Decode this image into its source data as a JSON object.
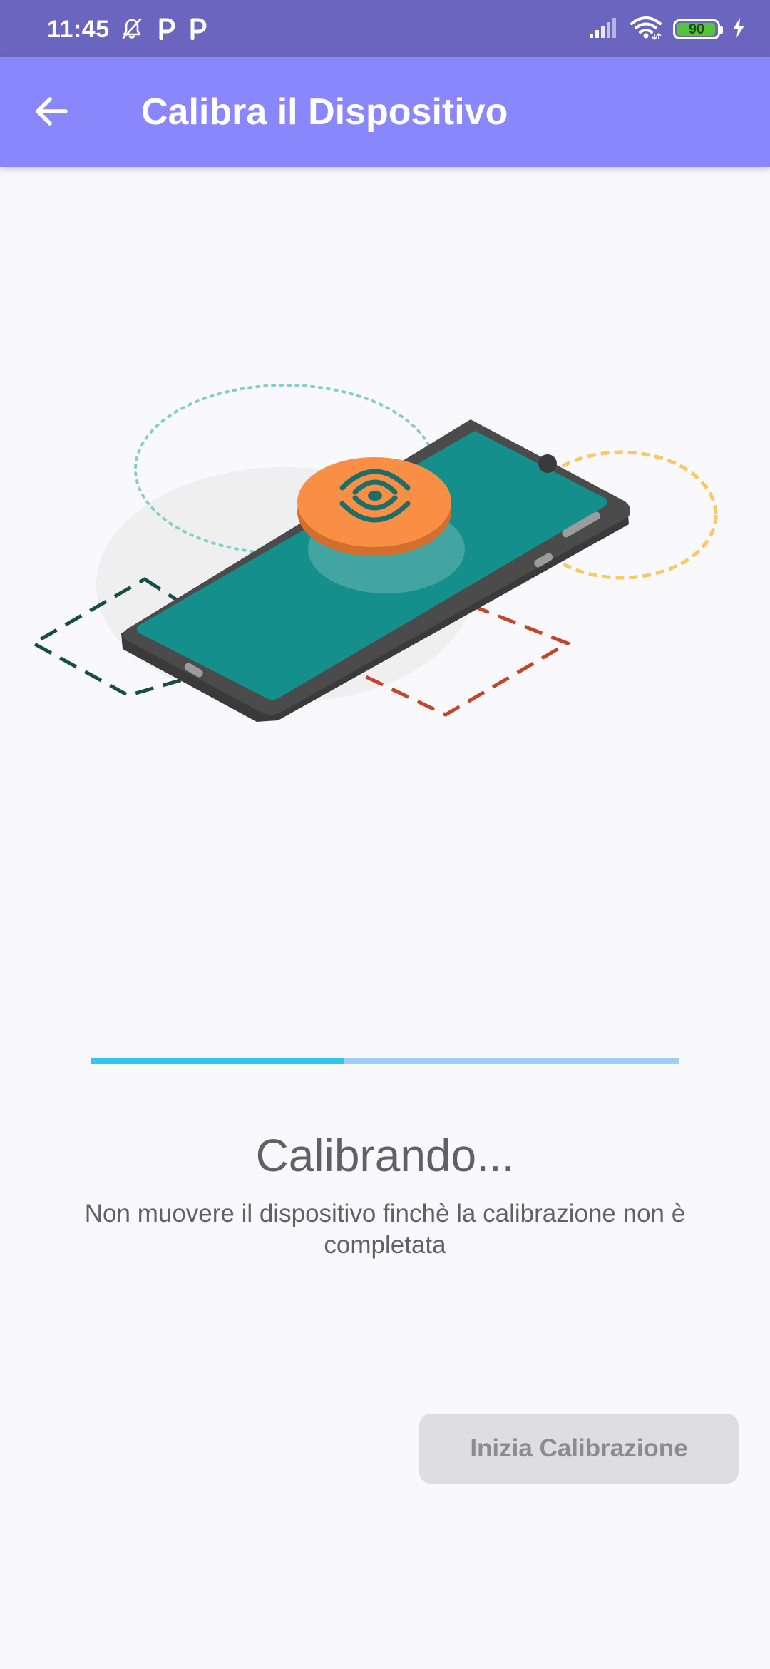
{
  "status_bar": {
    "time": "11:45",
    "battery_level": "90",
    "icons": [
      "bell-off-icon",
      "parking-p-icon",
      "parking-p-icon",
      "signal-icon",
      "wifi-icon",
      "battery-icon",
      "charging-bolt-icon"
    ]
  },
  "app_bar": {
    "title": "Calibra il Dispositivo",
    "back_icon": "arrow-back-icon"
  },
  "calibration": {
    "progress_fraction": 0.43,
    "title": "Calibrando...",
    "description": "Non muovere il dispositivo finchè la calibrazione non è completata",
    "button_label": "Inizia Calibrazione",
    "button_enabled": false
  },
  "colors": {
    "status_bar": "#6A66C0",
    "app_bar": "#8A87FC",
    "background": "#F9F9FD",
    "progress_fill": "#2FC6F0",
    "progress_track": "#9FCFF2",
    "text": "#616161",
    "button_bg": "#DEDEE2",
    "button_text": "#8C8C8C",
    "phone_screen": "#148F8C",
    "sensor_disc": "#F98F45"
  }
}
